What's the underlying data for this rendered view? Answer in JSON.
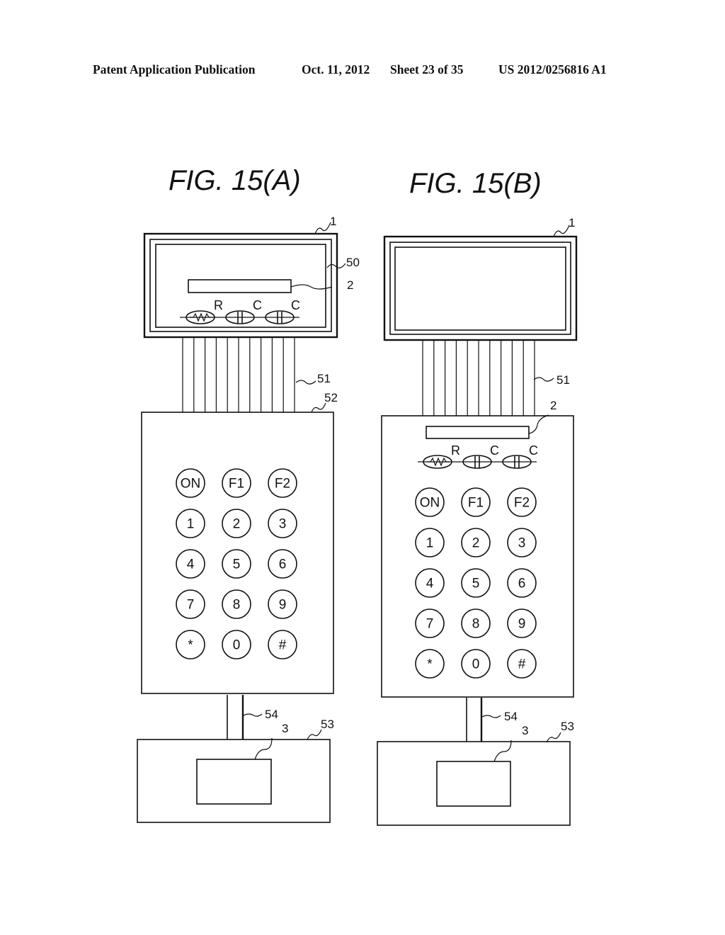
{
  "header": {
    "publication": "Patent Application Publication",
    "date": "Oct. 11, 2012",
    "sheet": "Sheet 23 of 35",
    "number": "US 2012/0256816 A1"
  },
  "figures": [
    {
      "id": "A",
      "title": "FIG.  15(A)",
      "refs": {
        "display": "1",
        "frame": "50",
        "strip": "2",
        "ribbon": "51",
        "keypad_body": "52",
        "cable": "54",
        "base": "53",
        "chip": "3"
      },
      "components": [
        "R",
        "C",
        "C"
      ],
      "ribbon_line_count": 11,
      "keys": [
        "ON",
        "F1",
        "F2",
        "1",
        "2",
        "3",
        "4",
        "5",
        "6",
        "7",
        "8",
        "9",
        "*",
        "0",
        "#"
      ]
    },
    {
      "id": "B",
      "title": "FIG.  15(B)",
      "refs": {
        "display": "1",
        "strip": "2",
        "ribbon": "51",
        "cable": "54",
        "base": "53",
        "chip": "3"
      },
      "components": [
        "R",
        "C",
        "C"
      ],
      "ribbon_line_count": 11,
      "keys": [
        "ON",
        "F1",
        "F2",
        "1",
        "2",
        "3",
        "4",
        "5",
        "6",
        "7",
        "8",
        "9",
        "*",
        "0",
        "#"
      ]
    }
  ]
}
